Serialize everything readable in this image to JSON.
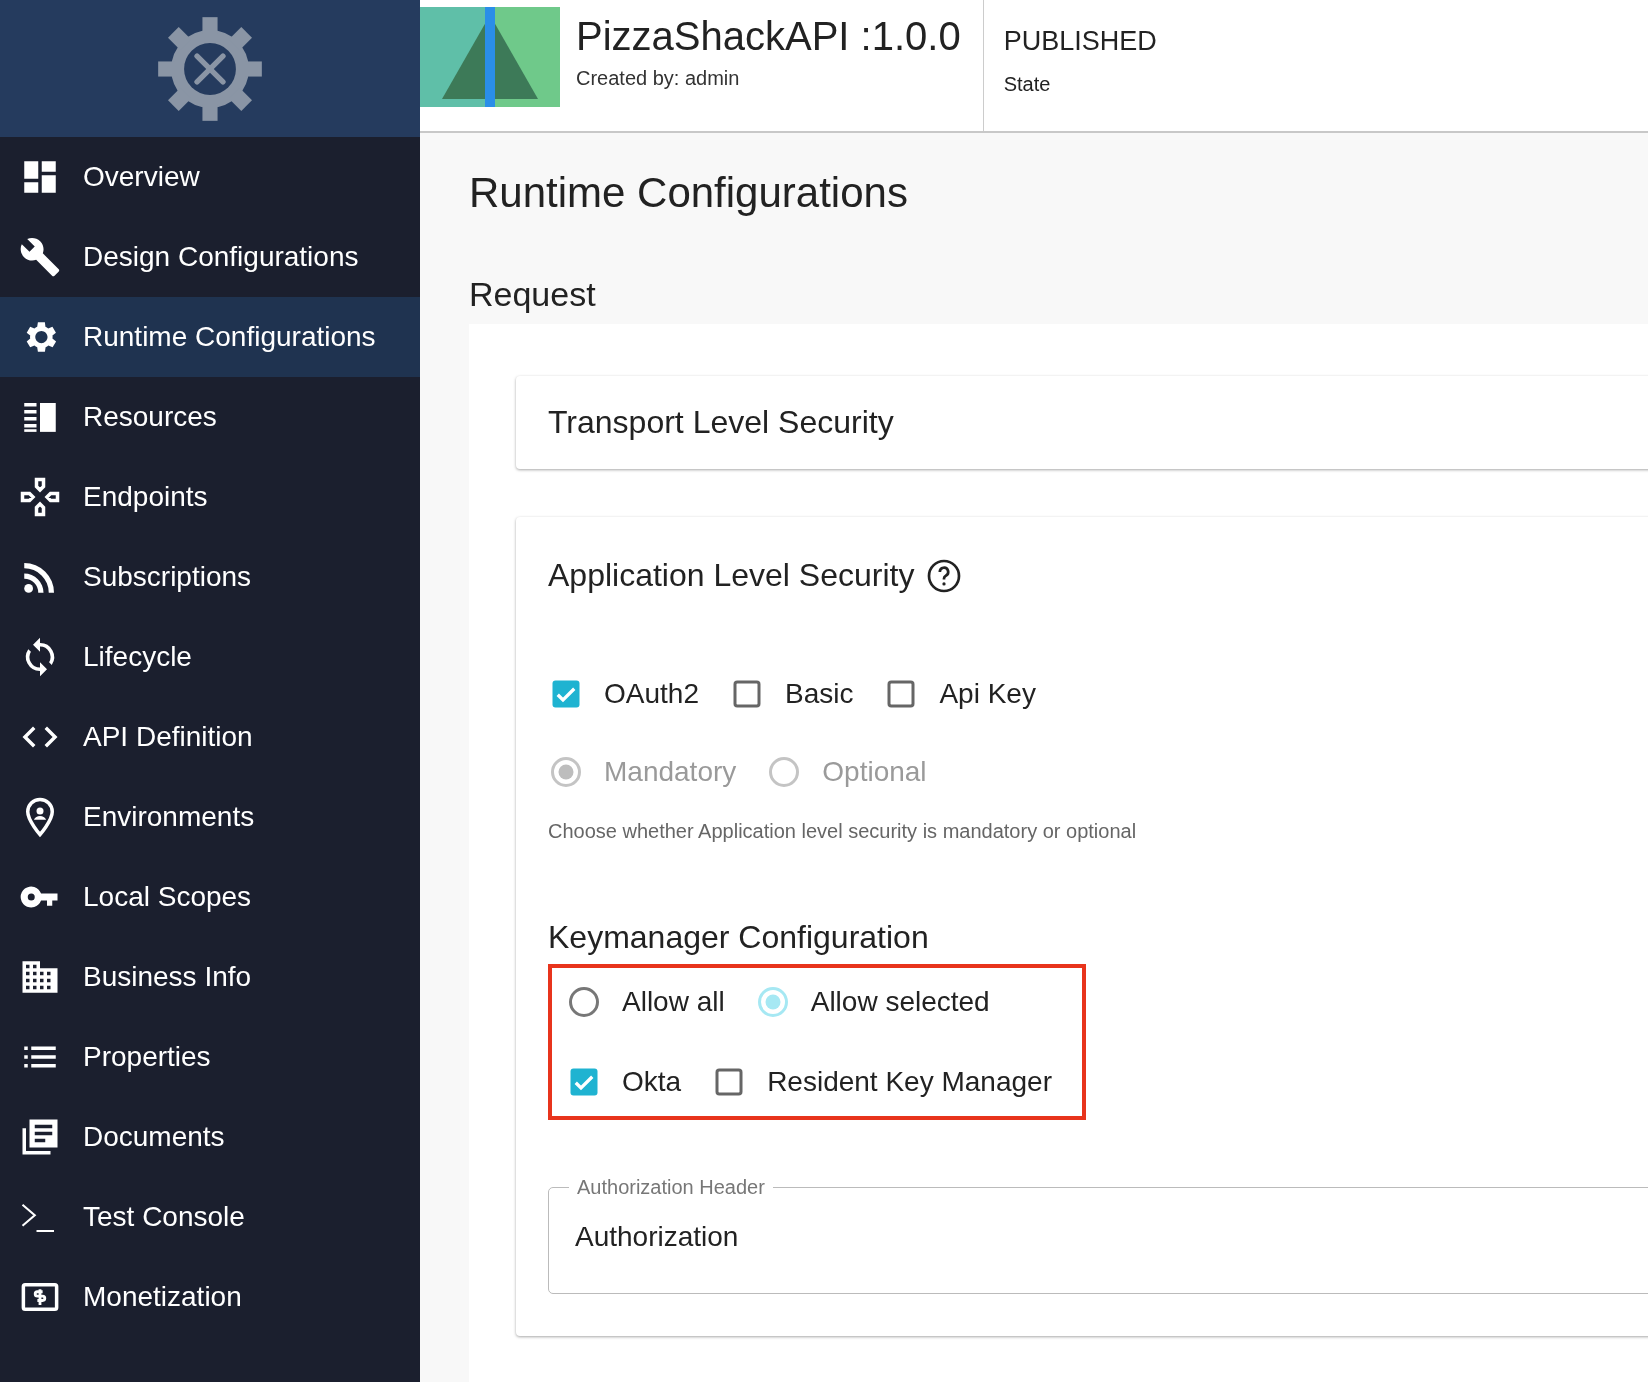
{
  "sidebar": {
    "items": [
      {
        "label": "Overview",
        "selected": false
      },
      {
        "label": "Design Configurations",
        "selected": false
      },
      {
        "label": "Runtime Configurations",
        "selected": true
      },
      {
        "label": "Resources",
        "selected": false
      },
      {
        "label": "Endpoints",
        "selected": false
      },
      {
        "label": "Subscriptions",
        "selected": false
      },
      {
        "label": "Lifecycle",
        "selected": false
      },
      {
        "label": "API Definition",
        "selected": false
      },
      {
        "label": "Environments",
        "selected": false
      },
      {
        "label": "Local Scopes",
        "selected": false
      },
      {
        "label": "Business Info",
        "selected": false
      },
      {
        "label": "Properties",
        "selected": false
      },
      {
        "label": "Documents",
        "selected": false
      },
      {
        "label": "Test Console",
        "selected": false
      },
      {
        "label": "Monetization",
        "selected": false
      }
    ]
  },
  "header": {
    "api_name": "PizzaShackAPI :1.0.0",
    "created_by": "Created by: admin",
    "state_value": "PUBLISHED",
    "state_label": "State"
  },
  "page_title": "Runtime Configurations",
  "section_title": "Request",
  "transport_card": {
    "title": "Transport Level Security"
  },
  "application_card": {
    "title": "Application Level Security",
    "security_options": [
      {
        "label": "OAuth2",
        "checked": true
      },
      {
        "label": "Basic",
        "checked": false
      },
      {
        "label": "Api Key",
        "checked": false
      }
    ],
    "requirement": {
      "disabled": true,
      "options": [
        {
          "label": "Mandatory",
          "selected": true
        },
        {
          "label": "Optional",
          "selected": false
        }
      ]
    },
    "helper_text": "Choose whether Application level security is mandatory or optional",
    "keymanager": {
      "title": "Keymanager Configuration",
      "highlighted": true,
      "modes": [
        {
          "label": "Allow all",
          "selected": false
        },
        {
          "label": "Allow selected",
          "selected": true
        }
      ],
      "managers": [
        {
          "label": "Okta",
          "checked": true
        },
        {
          "label": "Resident Key Manager",
          "checked": false
        }
      ]
    },
    "auth_header": {
      "label": "Authorization Header",
      "value": "Authorization"
    }
  }
}
